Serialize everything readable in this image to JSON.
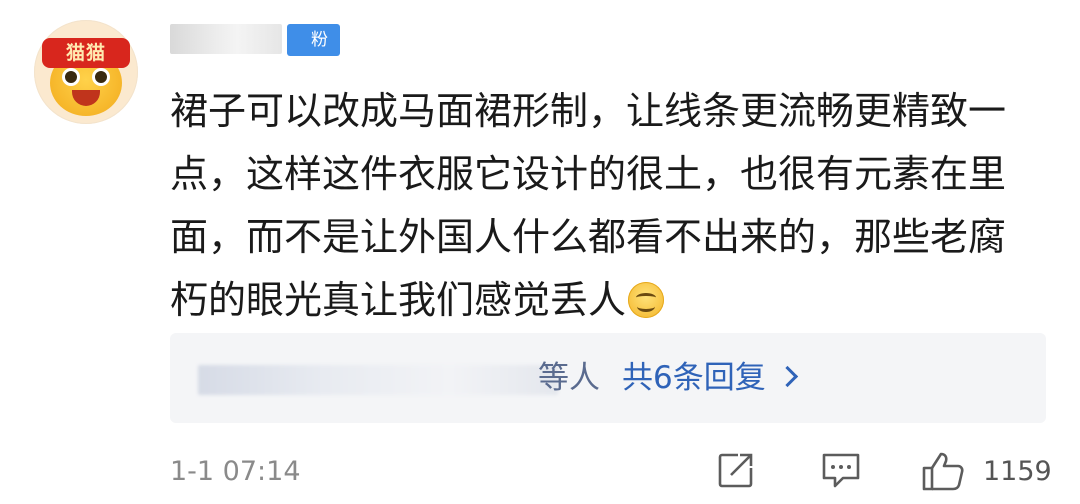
{
  "avatar": {
    "badge_text": "猫猫"
  },
  "user": {
    "fan_badge": "粉"
  },
  "comment": {
    "text": "裙子可以改成马面裙形制，让线条更流畅更精致一点，这样这件衣服它设计的很土，也很有元素在里面，而不是让外国人什么都看不出来的，那些老腐朽的眼光真让我们感觉丢人",
    "emoji": "smile-emoji"
  },
  "replies": {
    "tail_text": "等人",
    "link_text": "共6条回复",
    "chevron": "chevron-right-icon"
  },
  "footer": {
    "timestamp": "1-1 07:14",
    "like_count": "1159",
    "icons": [
      "share-icon",
      "comment-icon",
      "like-icon"
    ]
  },
  "colors": {
    "link": "#2f63b8",
    "fan_badge": "#3f8ee8",
    "reply_bg": "#f4f5f7",
    "avatar_badge": "#d8261d"
  }
}
